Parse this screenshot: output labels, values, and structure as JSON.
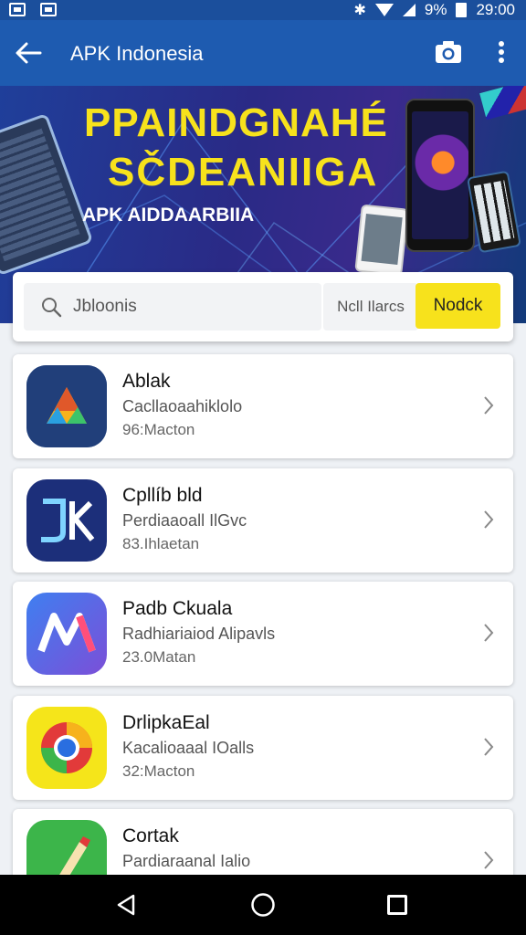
{
  "status_bar": {
    "battery_percent": "9%",
    "time": "29:00"
  },
  "app_bar": {
    "title": "APK Indonesia"
  },
  "banner": {
    "title_line1": "PPAINDGNAHÉ",
    "title_line2": "SČDEANIIGA",
    "subtitle": "APK AIDDAARBIIA"
  },
  "search": {
    "value": "Jbloonis",
    "filter_label": "Ncll Ilarcs",
    "button_label": "Nodck"
  },
  "apps": [
    {
      "name": "Ablak",
      "description": "Cacllaoaahiklolo",
      "size": "96:Macton"
    },
    {
      "name": "Cpllíb bld",
      "description": "Perdiaaoall IlGvc",
      "size": "83.Ihlaetan"
    },
    {
      "name": "Padb Ckuala",
      "description": "Radhiariaiod Alipavls",
      "size": "23.0Matan"
    },
    {
      "name": "DrlipkaEal",
      "description": "Kacalioaaal IOalls",
      "size": "32:Macton"
    },
    {
      "name": "Cortak",
      "description": "Pardiaraanal Ialio",
      "size": ""
    }
  ],
  "colors": {
    "primary": "#1e5bb0",
    "accent": "#f7e21c",
    "background": "#eef1f5"
  }
}
